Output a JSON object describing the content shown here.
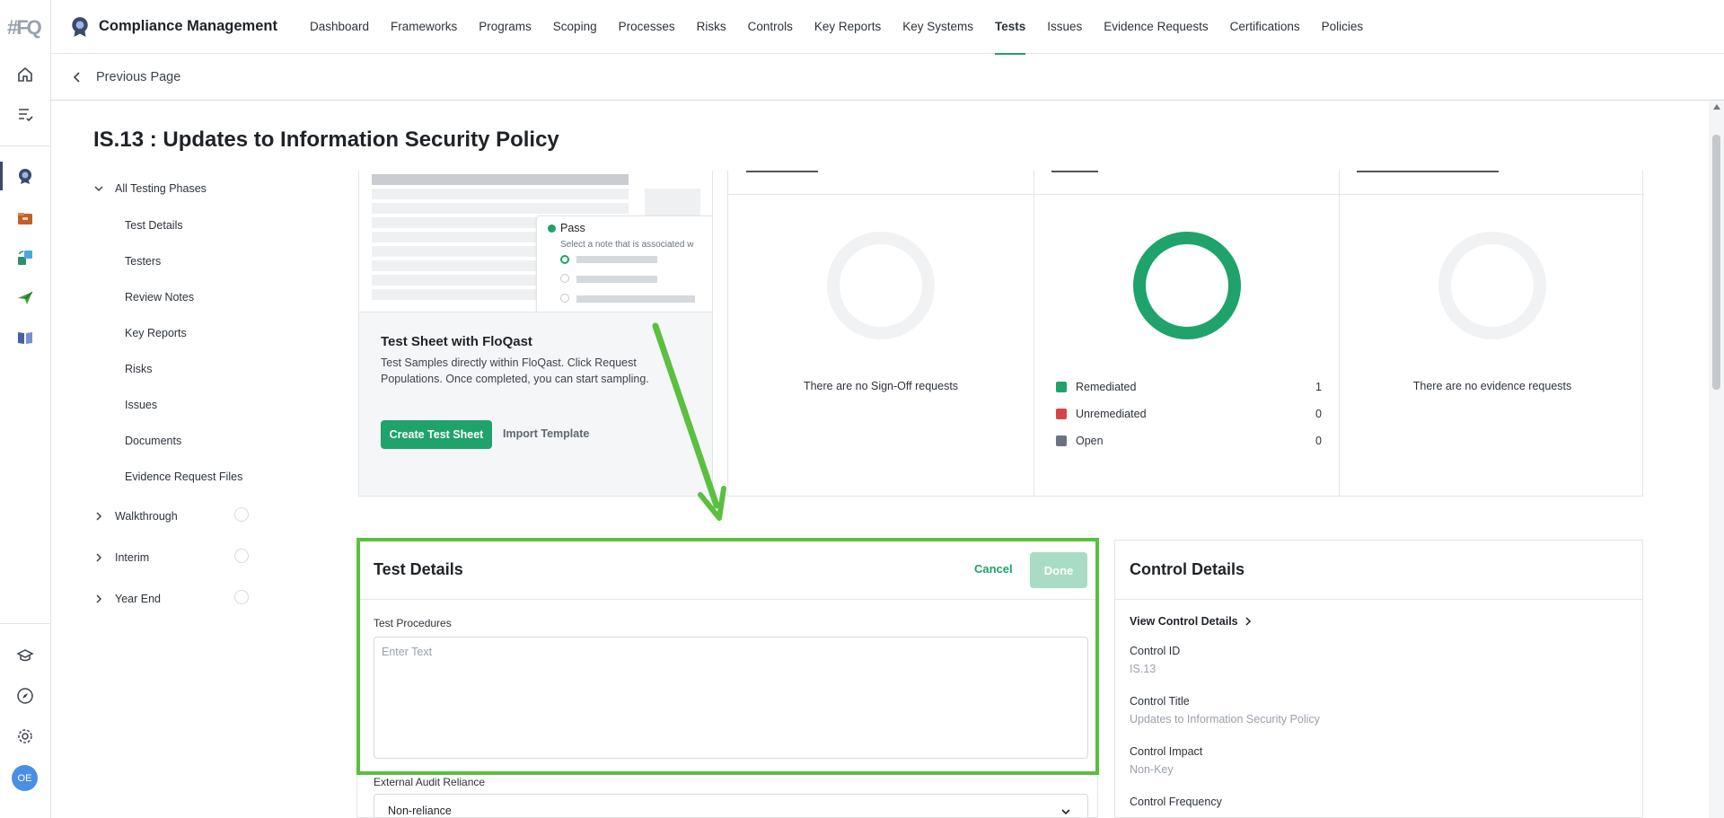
{
  "app": {
    "logo": "#FQ",
    "title": "Compliance Management"
  },
  "nav": {
    "items": [
      "Dashboard",
      "Frameworks",
      "Programs",
      "Scoping",
      "Processes",
      "Risks",
      "Controls",
      "Key Reports",
      "Key Systems",
      "Tests",
      "Issues",
      "Evidence Requests",
      "Certifications",
      "Policies"
    ],
    "active": "Tests"
  },
  "rail": {
    "top_icons": [
      "home-icon",
      "checklist-icon"
    ],
    "app_icons": [
      "compliance-badge-icon",
      "folder-icon",
      "sync-icon",
      "send-icon",
      "book-icon"
    ],
    "bottom_icons": [
      "academy-icon",
      "compass-icon",
      "gear-icon"
    ],
    "avatar_initials": "OE"
  },
  "previous_page": "Previous Page",
  "page_title": "IS.13 : Updates to Information Security Policy",
  "tree": {
    "root": "All Testing Phases",
    "children": [
      "Test Details",
      "Testers",
      "Review Notes",
      "Key Reports",
      "Risks",
      "Issues",
      "Documents",
      "Evidence Request Files"
    ],
    "phases": [
      "Walkthrough",
      "Interim",
      "Year End"
    ]
  },
  "promo": {
    "pass_label": "Pass",
    "pass_note": "Select a note that is associated w",
    "title": "Test Sheet with FloQast",
    "description": "Test Samples directly within FloQast. Click Request Populations. Once completed, you can start sampling.",
    "primary_button": "Create Test Sheet",
    "secondary_button": "Import Template"
  },
  "stats": {
    "signoff_empty": "There are no Sign-Off requests",
    "issues_legend": [
      {
        "label": "Remediated",
        "count": "1",
        "color": "#1fa36a"
      },
      {
        "label": "Unremediated",
        "count": "0",
        "color": "#d64545"
      },
      {
        "label": "Open",
        "count": "0",
        "color": "#6b7380"
      }
    ],
    "evidence_empty": "There are no evidence requests"
  },
  "test_details": {
    "title": "Test Details",
    "cancel": "Cancel",
    "done": "Done",
    "procedures_label": "Test Procedures",
    "procedures_placeholder": "Enter Text",
    "reliance_label": "External Audit Reliance",
    "reliance_value": "Non-reliance"
  },
  "control_details": {
    "title": "Control Details",
    "link": "View Control Details",
    "fields": [
      {
        "key": "Control ID",
        "value": "IS.13"
      },
      {
        "key": "Control Title",
        "value": "Updates to Information Security Policy"
      },
      {
        "key": "Control Impact",
        "value": "Non-Key"
      },
      {
        "key": "Control Frequency",
        "value": ""
      }
    ]
  },
  "colors": {
    "accent": "#1fa36a",
    "highlight": "#5bbf3f"
  }
}
